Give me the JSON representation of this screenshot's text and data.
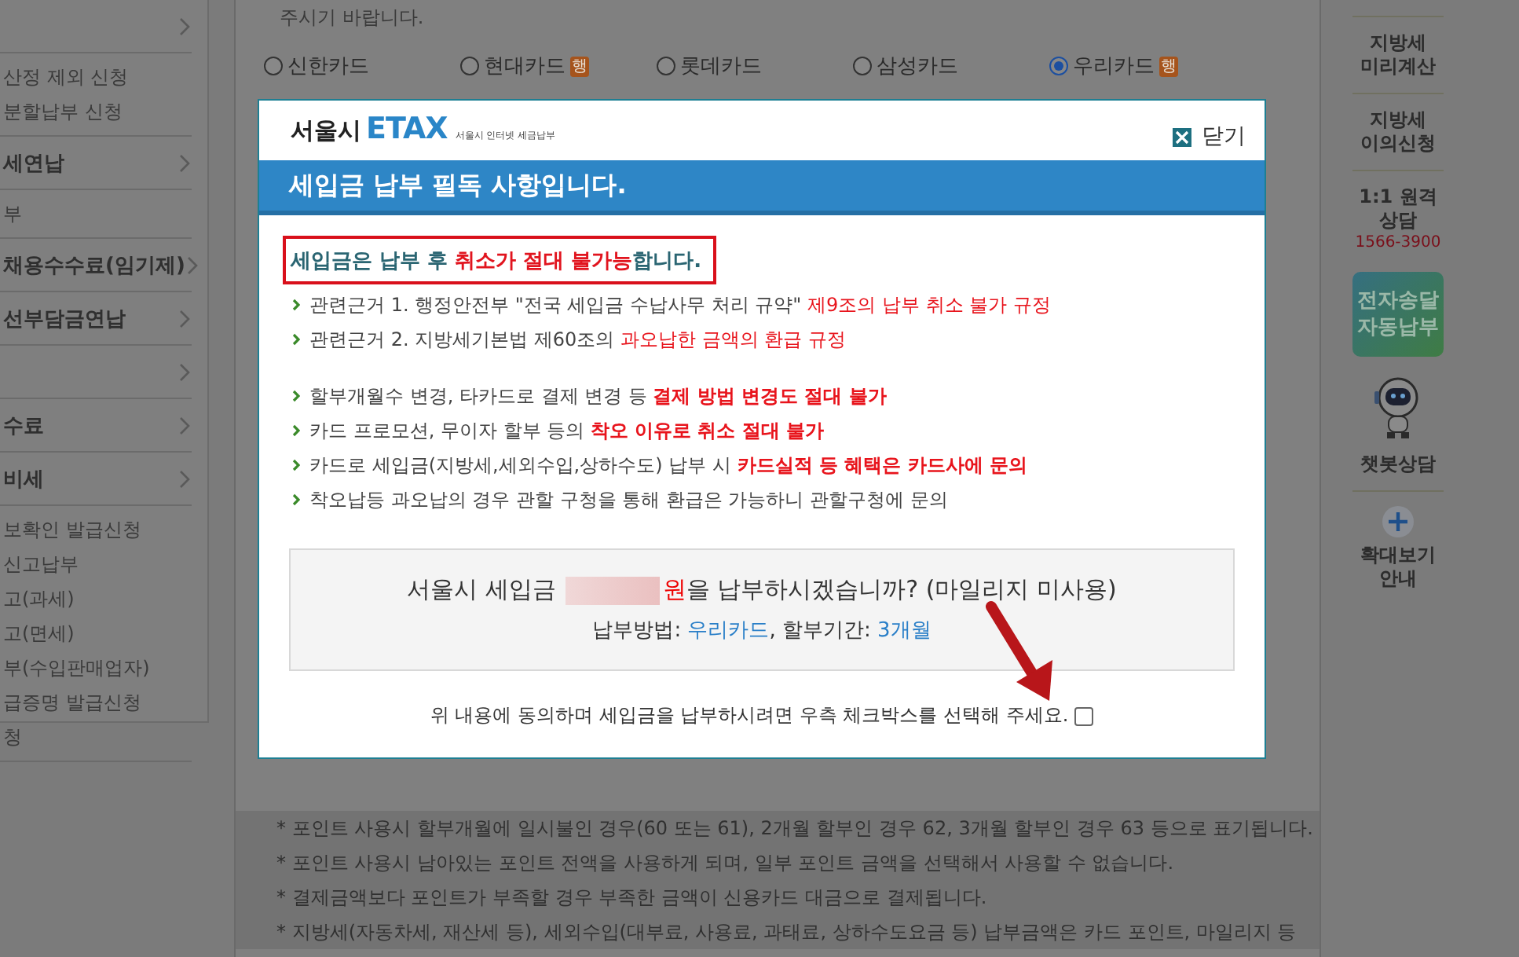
{
  "sidebar": {
    "items": [
      {
        "kind": "header"
      },
      {
        "kind": "sub",
        "label": "산정 제외 신청"
      },
      {
        "kind": "sub",
        "label": "분할납부 신청"
      },
      {
        "kind": "header",
        "label": "세연납"
      },
      {
        "kind": "sub",
        "label": "부"
      },
      {
        "kind": "header",
        "label": "채용수수료(임기제)"
      },
      {
        "kind": "header",
        "label": "선부담금연납"
      },
      {
        "kind": "header"
      },
      {
        "kind": "header",
        "label": "수료"
      },
      {
        "kind": "header",
        "label": "비세"
      },
      {
        "kind": "sub",
        "label": "보확인 발급신청"
      },
      {
        "kind": "sub",
        "label": "신고납부"
      },
      {
        "kind": "sub",
        "label": "고(과세)"
      },
      {
        "kind": "sub",
        "label": "고(면세)"
      },
      {
        "kind": "sub",
        "label": "부(수입판매업자)"
      },
      {
        "kind": "sub",
        "label": "급증명 발급신청"
      },
      {
        "kind": "sub",
        "label": "청"
      }
    ]
  },
  "main": {
    "intro": "주시기 바랍니다.",
    "cards": [
      {
        "label": "신한카드",
        "selected": false
      },
      {
        "label": "현대카드",
        "selected": false,
        "badge": "행"
      },
      {
        "label": "롯데카드",
        "selected": false
      },
      {
        "label": "삼성카드",
        "selected": false
      },
      {
        "label": "우리카드",
        "selected": true,
        "badge": "행"
      }
    ],
    "notes": [
      "* 포인트 사용시 할부개월에 일시불인 경우(60 또는 61), 2개월 할부인 경우 62, 3개월 할부인 경우 63 등으로 표기됩니다.",
      "* 포인트 사용시 남아있는 포인트 전액을 사용하게 되며, 일부 포인트 금액을 선택해서 사용할 수 없습니다.",
      "* 결제금액보다 포인트가 부족할 경우 부족한 금액이 신용카드 대금으로 결제됩니다.",
      "* 지방세(자동차세, 재산세 등), 세외수입(대부료, 사용료, 과태료, 상하수도요금 등) 납부금액은 카드 포인트, 마일리지 등"
    ]
  },
  "quick_menu": {
    "items": [
      {
        "kind": "link",
        "label": "지방세 미리계산"
      },
      {
        "kind": "link",
        "label": "지방세 이의신청"
      },
      {
        "kind": "phone",
        "label": "1:1 원격 상담",
        "phone": "1566-3900"
      },
      {
        "kind": "banner",
        "label": "전자송달 자동납부"
      },
      {
        "kind": "chatbot",
        "label": "챗봇상담"
      },
      {
        "kind": "zoom",
        "label": "확대보기 안내"
      }
    ]
  },
  "dialog": {
    "logo": {
      "city": "서울시",
      "brand": "ETAX",
      "tagline": "서울시 인터넷 세금납부"
    },
    "close_label": "닫기",
    "title": "세입금 납부 필독 사항입니다.",
    "notice": "세입금은 납부 후 **취소가 절대 불가능**합니다.",
    "groups": [
      [
        {
          "kind": "basis",
          "text": "관련근거 1. 행정안전부 \"전국 세입금 수납사무 처리 규약\" **제9조의 납부 취소 불가 규정**"
        },
        {
          "kind": "basis",
          "text": "관련근거 2. 지방세기본법 제60조의 **과오납한 금액의 환급 규정**"
        }
      ],
      [
        {
          "kind": "warning",
          "text": "할부개월수 변경, 타카드로 결제 변경 등 **결제 방법 변경도 절대 불가**"
        },
        {
          "kind": "warning",
          "text": "카드 프로모션, 무이자 할부 등의 **착오 이유로 취소 절대 불가**"
        },
        {
          "kind": "warning",
          "text": "카드로 세입금(지방세,세외수입,상하수도) 납부 시 **카드실적 등 혜택은 카드사에 문의**"
        },
        {
          "kind": "warning",
          "text": "착오납등 과오납의 경우 관할 구청을 통해 환급은 가능하니 관할구청에 문의"
        }
      ]
    ],
    "confirm": {
      "prefix": "서울시 세입금",
      "suffix": "**원**을 납부하시겠습니까? (마일리지 미사용)",
      "details": "납부방법: **우리카드**, 할부기간: **3개월**"
    },
    "agreement": {
      "text": "위 내용에 동의하며 세입금을 납부하시려면 우측 체크박스를 선택해 주세요.",
      "checked": false
    }
  }
}
